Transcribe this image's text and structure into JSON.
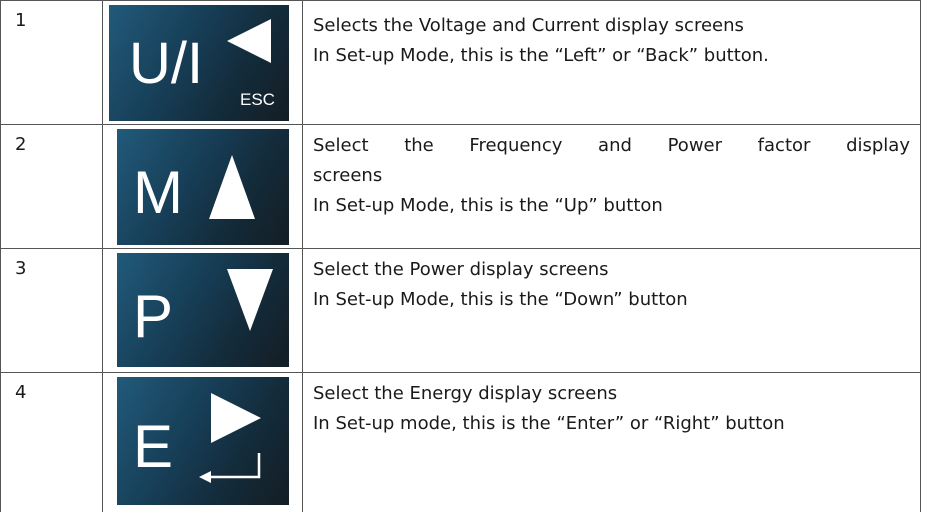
{
  "rows": [
    {
      "number": "1",
      "button_label": "U/I",
      "button_sublabel": "ESC",
      "arrow": "left-arrow-icon",
      "lines": [
        "Selects the Voltage and Current display screens",
        "In Set-up Mode, this is the “Left” or “Back” button."
      ]
    },
    {
      "number": "2",
      "button_label": "M",
      "arrow": "up-arrow-icon",
      "lines": [
        "Select the Frequency and Power factor display",
        "screens",
        "In Set-up Mode, this is the “Up” button"
      ]
    },
    {
      "number": "3",
      "button_label": "P",
      "arrow": "down-arrow-icon",
      "lines": [
        "Select the Power display screens",
        "In Set-up Mode, this is the “Down” button"
      ]
    },
    {
      "number": "4",
      "button_label": "E",
      "arrow": "right-arrow-enter-icon",
      "lines": [
        "Select the Energy display screens",
        "In Set-up mode, this is the “Enter” or “Right” button"
      ]
    }
  ],
  "colors": {
    "button_gradient_start": "#215a7a",
    "button_gradient_end": "#141d24",
    "button_text": "#ffffff",
    "border": "#555555"
  }
}
